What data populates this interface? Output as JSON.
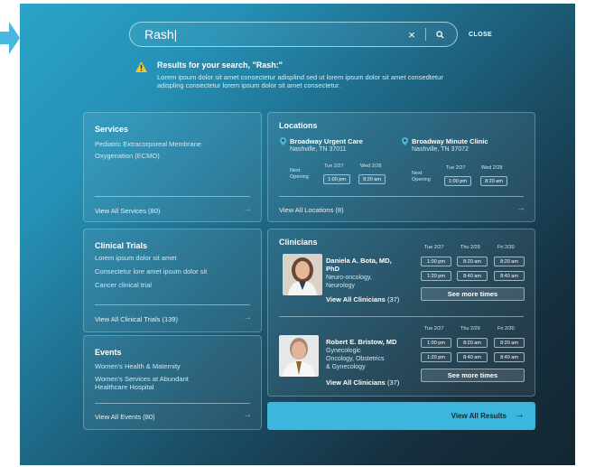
{
  "search": {
    "value": "Rash|",
    "clear_icon": "×",
    "close_label": "CLOSE"
  },
  "results": {
    "title": "Results for your search, \"Rash:\"",
    "body": "Lorem ipsum dolor sit amet consectetur adisplind sed ut lorem ipsum dolor sit amet consedtetur adispling consectetur lorem ipsum dolor sit amet consectetur."
  },
  "services": {
    "title": "Services",
    "items": [
      "Pediatric Extracorporeal Membrane",
      "Oxygenation (ECMO)"
    ],
    "footer": "View All Services (80)"
  },
  "clinical_trials": {
    "title": "Clinical Trials",
    "items": [
      "Lorem ipsum dolor sit amet",
      "Consectetur lore amet ipsum dolor sit",
      "Cancer clinical trial"
    ],
    "footer": "View All Clinical Trials (139)"
  },
  "events": {
    "title": "Events",
    "items": [
      "Women's Health & Maternity",
      "Women's Services at Abundant",
      "Healthcare Hospital"
    ],
    "footer": "View All Events (80)"
  },
  "locations": {
    "title": "Locations",
    "footer": "View All Locations (8)",
    "list": [
      {
        "name": "Broadway Urgent Care",
        "address": "Nashville, TN 37011",
        "next_label_1": "Next",
        "next_label_2": "Opening",
        "days": [
          "Tue 2/27",
          "Wed 2/28"
        ],
        "times": [
          "1:00 pm",
          "8:20 am"
        ]
      },
      {
        "name": "Broadway Minute Clinic",
        "address": "Nashville, TN 37072",
        "next_label_1": "Next",
        "next_label_2": "Opening",
        "days": [
          "Tue 2/27",
          "Wed 2/28"
        ],
        "times": [
          "1:00 pm",
          "8:20 am"
        ]
      }
    ]
  },
  "clinicians": {
    "title": "Clinicians",
    "list": [
      {
        "name_1": "Daniela A. Bota, MD,",
        "name_2": "PhD",
        "spec_1": "Neuro-oncology,",
        "spec_2": "Neurology",
        "spec_3": "",
        "link_label": "View All Clinicians",
        "link_count": "(37)",
        "days": [
          "Tue 2/27",
          "Thu 2/29",
          "Fri 2/30"
        ],
        "times_row1": [
          "1:00 pm",
          "8:20 am",
          "8:20 am"
        ],
        "times_row2": [
          "1:20 pm",
          "8:40 am",
          "8:40 am"
        ],
        "more_label": "See more times"
      },
      {
        "name_1": "Robert E. Bristow, MD",
        "name_2": "",
        "spec_1": "Gynecologic",
        "spec_2": "Oncology, Obstetrics",
        "spec_3": "& Gynecology",
        "link_label": "View All Clinicians",
        "link_count": "(37)",
        "days": [
          "Tue 2/27",
          "Thu 2/29",
          "Fri 2/30"
        ],
        "times_row1": [
          "1:00 pm",
          "8:20 am",
          "8:20 am"
        ],
        "times_row2": [
          "1:20 pm",
          "8:40 am",
          "8:40 am"
        ],
        "more_label": "See more times"
      }
    ]
  },
  "view_all_results": {
    "label": "View All Results",
    "arrow": "→"
  },
  "arrow_glyph": "→",
  "colors": {
    "accent": "#3cb6dc",
    "warning": "#f2c230",
    "pin": "#49b6dd",
    "panel_dark": "#132631"
  }
}
